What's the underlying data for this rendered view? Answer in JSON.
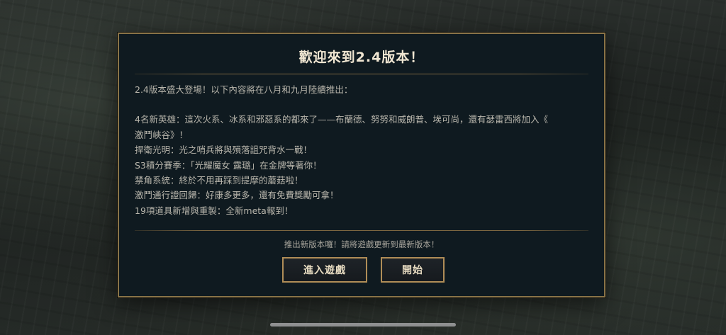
{
  "dialog": {
    "title": "歡迎來到2.4版本！",
    "lines": [
      "2.4版本盛大登場！以下內容將在八月和九月陸續推出：",
      "4名新英雄：這次火系、冰系和邪惡系的都來了——布蘭德、努努和威朗普、埃可尚，還有瑟雷西將加入《",
      "激鬥峽谷》！",
      "捍衛光明：光之哨兵將與殞落詛咒背水一戰！",
      "S3積分賽季：「光耀魔女 露璐」在金牌等著你！",
      "禁角系統：終於不用再踩到提摩的蘑菇啦！",
      "激鬥通行證回歸：好康多更多，還有免費獎勵可拿！",
      "19項道具新增與重製：全新meta報到！"
    ],
    "footer_note": "推出新版本囉！請將遊戲更新到最新版本！",
    "enter_game_label": "進入遊戲",
    "start_label": "開始"
  },
  "colors": {
    "panel_bg": "#0f1a20",
    "gold_border": "#8a7448",
    "title_text": "#f0e6d2",
    "body_text": "#b9b6ac"
  }
}
